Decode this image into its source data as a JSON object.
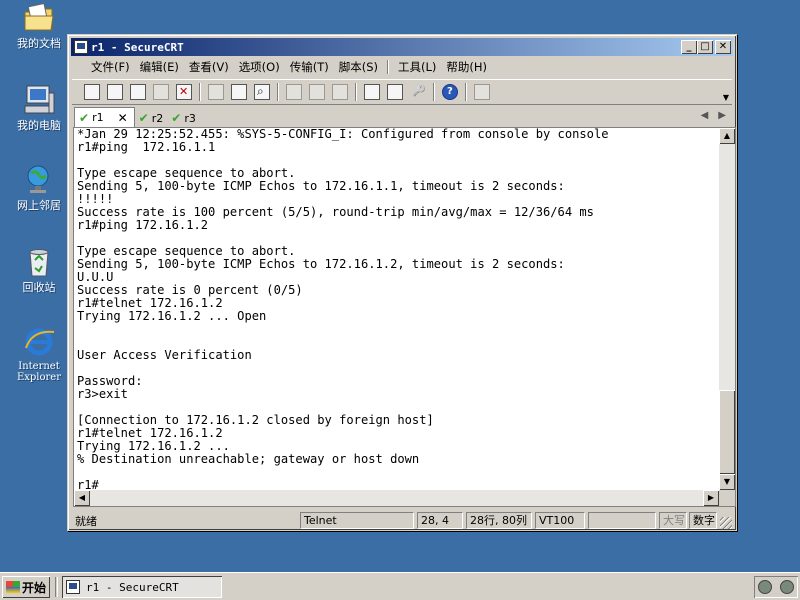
{
  "desktop": {
    "icons": [
      {
        "label": "我的文档",
        "icon": "folder-documents-icon"
      },
      {
        "label": "我的电脑",
        "icon": "computer-icon"
      },
      {
        "label": "网上邻居",
        "icon": "network-icon"
      },
      {
        "label": "回收站",
        "icon": "recycle-bin-icon"
      },
      {
        "label": "Internet Explorer",
        "label_line1": "Internet",
        "label_line2": "Explorer",
        "icon": "ie-icon"
      }
    ]
  },
  "window": {
    "title": "r1 - SecureCRT",
    "buttons": {
      "minimize": "_",
      "maximize": "□",
      "close": "✕"
    }
  },
  "menu": [
    "文件(F)",
    "编辑(E)",
    "查看(V)",
    "选项(O)",
    "传输(T)",
    "脚本(S)",
    "工具(L)",
    "帮助(H)"
  ],
  "tabs": [
    {
      "label": "r1",
      "active": true,
      "close": "✕"
    },
    {
      "label": "r2",
      "active": false
    },
    {
      "label": "r3",
      "active": false
    }
  ],
  "terminal": {
    "lines": [
      "*Jan 29 12:25:52.455: %SYS-5-CONFIG_I: Configured from console by console",
      "r1#ping  172.16.1.1",
      "",
      "Type escape sequence to abort.",
      "Sending 5, 100-byte ICMP Echos to 172.16.1.1, timeout is 2 seconds:",
      "!!!!!",
      "Success rate is 100 percent (5/5), round-trip min/avg/max = 12/36/64 ms",
      "r1#ping 172.16.1.2",
      "",
      "Type escape sequence to abort.",
      "Sending 5, 100-byte ICMP Echos to 172.16.1.2, timeout is 2 seconds:",
      "U.U.U",
      "Success rate is 0 percent (0/5)",
      "r1#telnet 172.16.1.2",
      "Trying 172.16.1.2 ... Open",
      "",
      "",
      "User Access Verification",
      "",
      "Password:",
      "r3>exit",
      "",
      "[Connection to 172.16.1.2 closed by foreign host]",
      "r1#telnet 172.16.1.2",
      "Trying 172.16.1.2 ...",
      "% Destination unreachable; gateway or host down",
      "",
      "r1#"
    ]
  },
  "status": {
    "ready": "就绪",
    "protocol": "Telnet",
    "cursor": "28,  4",
    "size": "28行, 80列",
    "emulation": "VT100",
    "caps": "大写",
    "num": "数字"
  },
  "taskbar": {
    "start_label": "开始",
    "task_label": "r1 - SecureCRT"
  }
}
